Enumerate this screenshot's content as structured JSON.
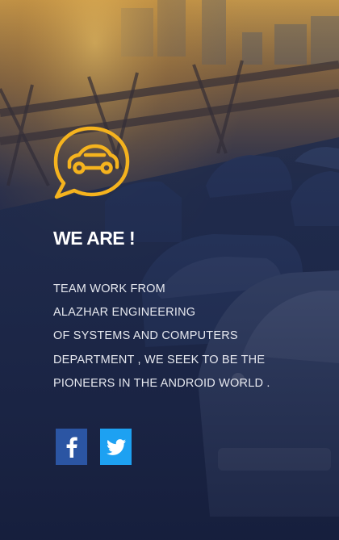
{
  "about": {
    "heading": "WE ARE !",
    "lines": [
      "TEAM WORK FROM",
      "ALAZHAR ENGINEERING",
      "OF SYSTEMS AND COMPUTERS",
      "DEPARTMENT , WE SEEK TO BE THE",
      "PIONEERS IN THE ANDROID WORLD ."
    ]
  },
  "logo": {
    "icon": "car-chat-bubble-icon",
    "color": "#f5b31e"
  },
  "social": {
    "facebook": {
      "icon": "facebook-icon",
      "color": "#2b55a3"
    },
    "twitter": {
      "icon": "twitter-icon",
      "color": "#1da1f2"
    }
  },
  "background": {
    "description_icon": "traffic-bridge-background"
  }
}
